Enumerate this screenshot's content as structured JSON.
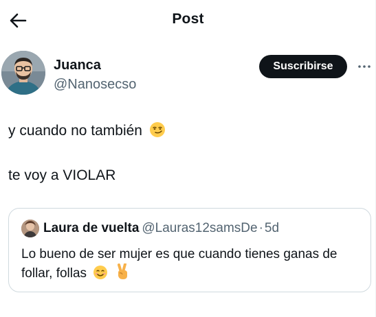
{
  "header": {
    "title": "Post",
    "back_icon": "arrow-left-icon"
  },
  "author": {
    "name": "Juanca",
    "handle": "@Nanosecso",
    "subscribe_label": "Suscribirse",
    "more_icon": "more-horizontal-icon"
  },
  "tweet": {
    "line1": "y cuando no también",
    "line1_emoji": "smirking-face-icon",
    "line2": "te voy a VIOLAR"
  },
  "quote": {
    "name": "Laura de vuelta",
    "handle": "@Lauras12samsDe",
    "separator": "·",
    "time": "5d",
    "body": "Lo bueno de ser mujer es que cuando tienes ganas de follar, follas",
    "emojis": [
      "smiling-face-icon",
      "victory-hand-icon"
    ]
  },
  "colors": {
    "text": "#0f1419",
    "secondary": "#536471",
    "border": "#cfd9de",
    "button_bg": "#0f1419"
  }
}
